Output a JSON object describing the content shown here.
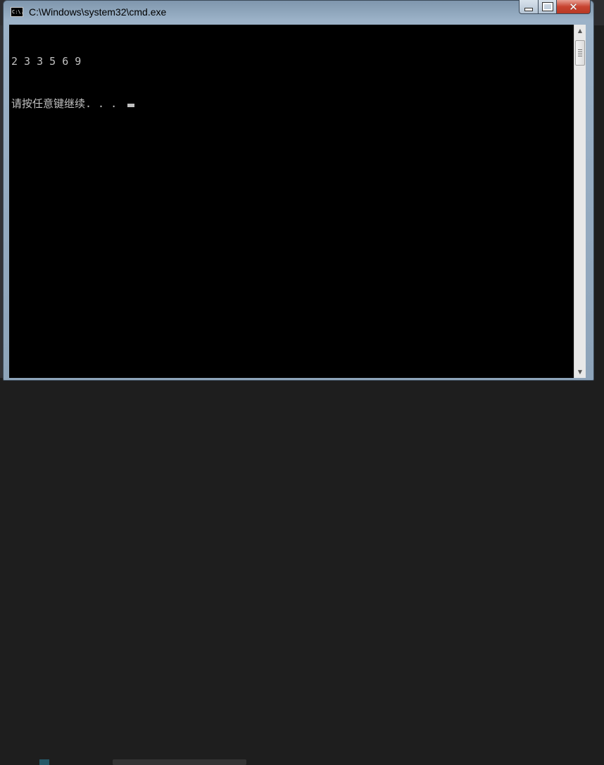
{
  "window": {
    "title": "C:\\Windows\\system32\\cmd.exe",
    "icon_text": "C:\\.",
    "controls": {
      "minimize": "minimize",
      "maximize": "maximize",
      "close": "✕"
    }
  },
  "console": {
    "lines": [
      "2 3 3 5 6 9",
      "请按任意键继续. . . "
    ],
    "foreground": "#c0c0c0",
    "background": "#000000"
  },
  "scrollbar": {
    "up": "▲",
    "down": "▼"
  }
}
